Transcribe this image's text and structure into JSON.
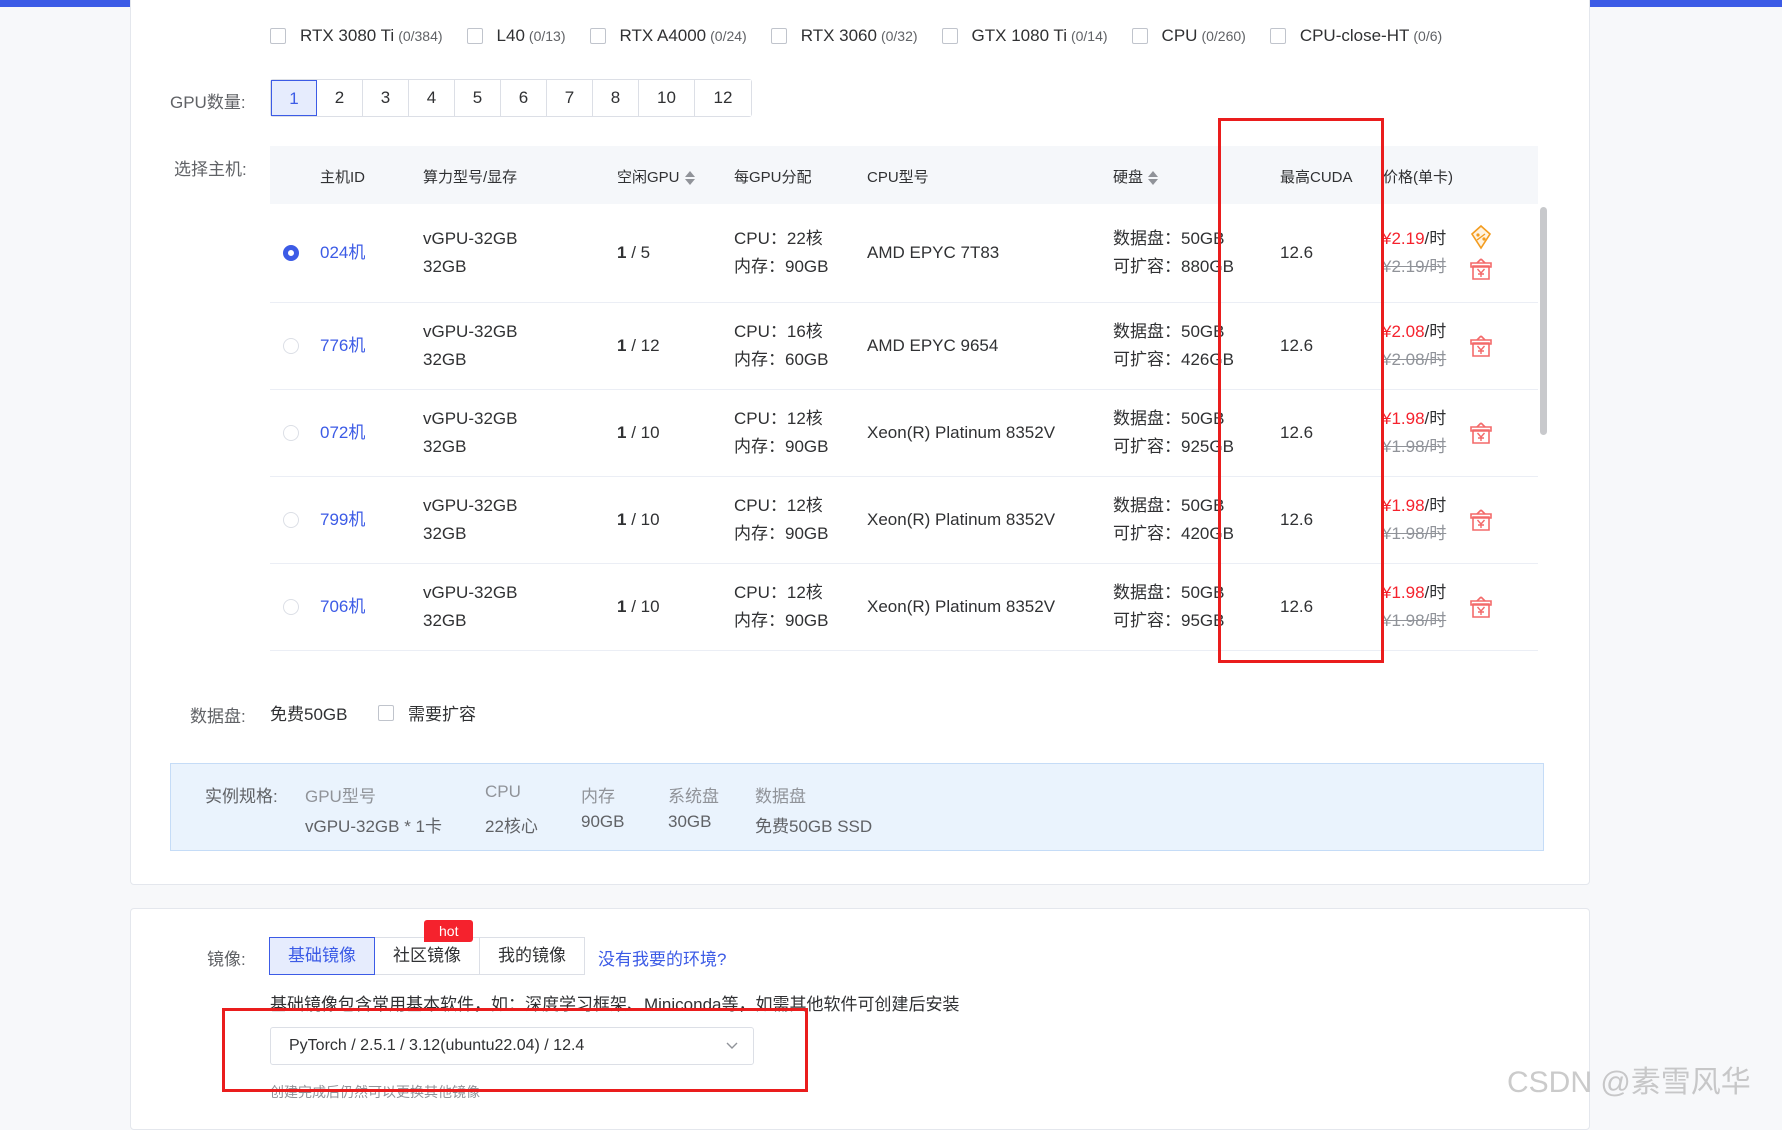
{
  "gpu_filters": [
    {
      "name": "RTX 3080 Ti",
      "count": "(0/384)"
    },
    {
      "name": "L40",
      "count": "(0/13)"
    },
    {
      "name": "RTX A4000",
      "count": "(0/24)"
    },
    {
      "name": "RTX 3060",
      "count": "(0/32)"
    },
    {
      "name": "GTX 1080 Ti",
      "count": "(0/14)"
    },
    {
      "name": "CPU",
      "count": "(0/260)"
    },
    {
      "name": "CPU-close-HT",
      "count": "(0/6)"
    }
  ],
  "gpu_count": {
    "label": "GPU数量:",
    "options": [
      "1",
      "2",
      "3",
      "4",
      "5",
      "6",
      "7",
      "8",
      "10",
      "12"
    ],
    "selected": "1"
  },
  "host_select": {
    "label": "选择主机:",
    "columns": [
      "主机ID",
      "算力型号/显存",
      "空闲GPU",
      "每GPU分配",
      "CPU型号",
      "硬盘",
      "最高CUDA",
      "价格(单卡)"
    ],
    "rows": [
      {
        "id": "024机",
        "model": "vGPU-32GB",
        "vram": "32GB",
        "free_a": "1",
        "free_b": " / 5",
        "cpu": "CPU：22核",
        "mem": "内存：90GB",
        "cpu_model": "AMD EPYC 7T83",
        "disk": "数据盘：50GB",
        "expand": "可扩容：880GB",
        "cuda": "12.6",
        "price_now": "¥2.19",
        "price_unit": "/时",
        "price_old": "¥2.19/时",
        "selected": true,
        "badges": [
          "discount-badge",
          "yuan-badge"
        ]
      },
      {
        "id": "776机",
        "model": "vGPU-32GB",
        "vram": "32GB",
        "free_a": "1",
        "free_b": " / 12",
        "cpu": "CPU：16核",
        "mem": "内存：60GB",
        "cpu_model": "AMD EPYC 9654",
        "disk": "数据盘：50GB",
        "expand": "可扩容：426GB",
        "cuda": "12.6",
        "price_now": "¥2.08",
        "price_unit": "/时",
        "price_old": "¥2.08/时",
        "selected": false,
        "badges": [
          "yuan-badge"
        ]
      },
      {
        "id": "072机",
        "model": "vGPU-32GB",
        "vram": "32GB",
        "free_a": "1",
        "free_b": " / 10",
        "cpu": "CPU：12核",
        "mem": "内存：90GB",
        "cpu_model": "Xeon(R) Platinum 8352V",
        "disk": "数据盘：50GB",
        "expand": "可扩容：925GB",
        "cuda": "12.6",
        "price_now": "¥1.98",
        "price_unit": "/时",
        "price_old": "¥1.98/时",
        "selected": false,
        "badges": [
          "yuan-badge"
        ]
      },
      {
        "id": "799机",
        "model": "vGPU-32GB",
        "vram": "32GB",
        "free_a": "1",
        "free_b": " / 10",
        "cpu": "CPU：12核",
        "mem": "内存：90GB",
        "cpu_model": "Xeon(R) Platinum 8352V",
        "disk": "数据盘：50GB",
        "expand": "可扩容：420GB",
        "cuda": "12.6",
        "price_now": "¥1.98",
        "price_unit": "/时",
        "price_old": "¥1.98/时",
        "selected": false,
        "badges": [
          "yuan-badge"
        ]
      },
      {
        "id": "706机",
        "model": "vGPU-32GB",
        "vram": "32GB",
        "free_a": "1",
        "free_b": " / 10",
        "cpu": "CPU：12核",
        "mem": "内存：90GB",
        "cpu_model": "Xeon(R) Platinum 8352V",
        "disk": "数据盘：50GB",
        "expand": "可扩容：95GB",
        "cuda": "12.6",
        "price_now": "¥1.98",
        "price_unit": "/时",
        "price_old": "¥1.98/时",
        "selected": false,
        "badges": [
          "yuan-badge"
        ]
      }
    ]
  },
  "data_disk": {
    "label": "数据盘:",
    "free": "免费50GB",
    "expand_label": "需要扩容"
  },
  "instance_spec": {
    "label": "实例规格:",
    "fields": [
      {
        "key": "GPU型号",
        "value": "vGPU-32GB * 1卡"
      },
      {
        "key": "CPU",
        "value": "22核心"
      },
      {
        "key": "内存",
        "value": "90GB"
      },
      {
        "key": "系统盘",
        "value": "30GB"
      },
      {
        "key": "数据盘",
        "value": "免费50GB SSD"
      }
    ]
  },
  "image": {
    "label": "镜像:",
    "tabs": [
      "基础镜像",
      "社区镜像",
      "我的镜像"
    ],
    "active_tab": "基础镜像",
    "hot_badge": "hot",
    "missing_link": "没有我要的环境?",
    "note": "基础镜像包含常用基本软件，如：深度学习框架、Miniconda等，如需其他软件可创建后安装",
    "selected_value": "PyTorch / 2.5.1 / 3.12(ubuntu22.04) / 12.4",
    "footer_note": "创建完成后仍然可以更换其他镜像"
  },
  "watermark": "CSDN @素雪风华",
  "colors": {
    "accent": "#3c5be6",
    "price_red": "#f5222d",
    "highlight_box": "#ea1d1d",
    "spec_bg": "#eaf3fd"
  }
}
